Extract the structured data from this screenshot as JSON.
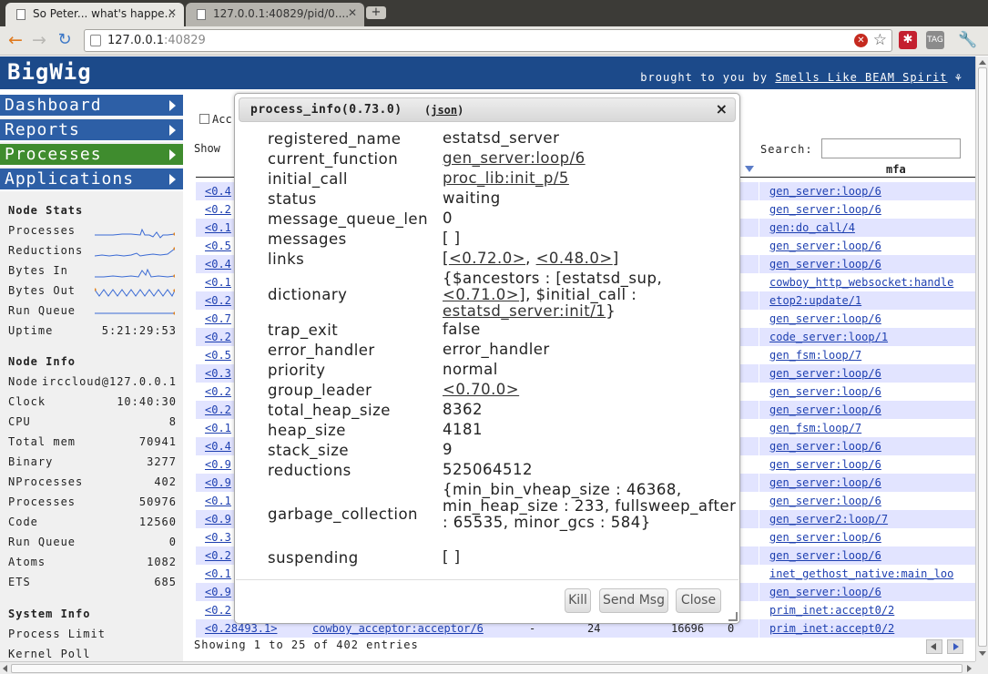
{
  "browser": {
    "tabs": [
      {
        "title": "So Peter... what's happe..."
      },
      {
        "title": "127.0.0.1:40829/pid/0...."
      }
    ],
    "url_host": "127.0.0.1",
    "url_port": ":40829"
  },
  "header": {
    "brand": "BigWig",
    "credit_prefix": "brought to you by",
    "credit_link": "Smells Like BEAM Spirit",
    "credit_icon": "⚘"
  },
  "sidebar": {
    "nav": [
      {
        "label": "Dashboard"
      },
      {
        "label": "Reports"
      },
      {
        "label": "Processes"
      },
      {
        "label": "Applications"
      }
    ],
    "node_stats": {
      "title": "Node Stats",
      "rows": [
        {
          "label": "Processes"
        },
        {
          "label": "Reductions"
        },
        {
          "label": "Bytes In"
        },
        {
          "label": "Bytes Out"
        },
        {
          "label": "Run Queue"
        },
        {
          "label": "Uptime",
          "value": "5:21:29:53"
        }
      ]
    },
    "node_info": {
      "title": "Node Info",
      "rows": [
        {
          "label": "Node",
          "value": "irccloud@127.0.0.1"
        },
        {
          "label": "Clock",
          "value": "10:40:30"
        },
        {
          "label": "CPU",
          "value": "8"
        },
        {
          "label": "Total mem",
          "value": "70941"
        },
        {
          "label": "Binary",
          "value": "3277"
        },
        {
          "label": "NProcesses",
          "value": "402"
        },
        {
          "label": "Processes",
          "value": "50976"
        },
        {
          "label": "Code",
          "value": "12560"
        },
        {
          "label": "Run Queue",
          "value": "0"
        },
        {
          "label": "Atoms",
          "value": "1082"
        },
        {
          "label": "ETS",
          "value": "685"
        }
      ]
    },
    "system_info": {
      "title": "System Info",
      "rows": [
        {
          "label": "Process Limit"
        },
        {
          "label": "Kernel Poll"
        }
      ]
    }
  },
  "main": {
    "accumulate_label": "Acc",
    "show_label": "Show",
    "search_label": "Search:",
    "mfa_header": "mfa",
    "rows": [
      {
        "pid": "<0.4",
        "mfa": "gen_server:loop/6"
      },
      {
        "pid": "<0.2",
        "mfa": "gen_server:loop/6"
      },
      {
        "pid": "<0.1",
        "mfa": "gen:do_call/4"
      },
      {
        "pid": "<0.5",
        "mfa": "gen_server:loop/6"
      },
      {
        "pid": "<0.4",
        "mfa": "gen_server:loop/6"
      },
      {
        "pid": "<0.1",
        "mfa": "cowboy_http_websocket:handle"
      },
      {
        "pid": "<0.2",
        "mfa": "etop2:update/1"
      },
      {
        "pid": "<0.7",
        "mfa": "gen_server:loop/6"
      },
      {
        "pid": "<0.2",
        "mfa": "code_server:loop/1"
      },
      {
        "pid": "<0.5",
        "mfa": "gen_fsm:loop/7"
      },
      {
        "pid": "<0.3",
        "mfa": "gen_server:loop/6"
      },
      {
        "pid": "<0.2",
        "mfa": "gen_server:loop/6"
      },
      {
        "pid": "<0.2",
        "mfa": "gen_server:loop/6"
      },
      {
        "pid": "<0.1",
        "mfa": "gen_fsm:loop/7"
      },
      {
        "pid": "<0.4",
        "mfa": "gen_server:loop/6"
      },
      {
        "pid": "<0.9",
        "mfa": "gen_server:loop/6"
      },
      {
        "pid": "<0.9",
        "mfa": "gen_server:loop/6"
      },
      {
        "pid": "<0.1",
        "mfa": "gen_server:loop/6"
      },
      {
        "pid": "<0.9",
        "mfa": "gen_server2:loop/7"
      },
      {
        "pid": "<0.3",
        "mfa": "gen_server:loop/6"
      },
      {
        "pid": "<0.2",
        "mfa": "gen_server:loop/6"
      },
      {
        "pid": "<0.1",
        "mfa": "inet_gethost_native:main_loo"
      },
      {
        "pid": "<0.9",
        "mfa": "gen_server:loop/6"
      },
      {
        "pid": "<0.2",
        "mfa": "prim_inet:accept0/2"
      }
    ],
    "last_row": {
      "pid": "<0.28493.1>",
      "current_function": "cowboy_acceptor:acceptor/6",
      "c3": "-",
      "c4": "24",
      "c5": "16696",
      "c6": "0",
      "mfa": "prim_inet:accept0/2"
    },
    "showing_text": "Showing 1 to 25 of 402 entries"
  },
  "dialog": {
    "title": "process_info(0.73.0)",
    "json_link": "(json)",
    "close_glyph": "×",
    "fields": {
      "registered_name": {
        "key": "registered_name",
        "value": "estatsd_server"
      },
      "current_function": {
        "key": "current_function",
        "value": "gen_server:loop/6"
      },
      "initial_call": {
        "key": "initial_call",
        "value": "proc_lib:init_p/5"
      },
      "status": {
        "key": "status",
        "value": "waiting"
      },
      "message_queue_len": {
        "key": "message_queue_len",
        "value": "0"
      },
      "messages": {
        "key": "messages",
        "value": "[ ]"
      },
      "links": {
        "key": "links",
        "open": "[",
        "link1": "<0.72.0>",
        "comma": ", ",
        "link2": "<0.48.0>",
        "close": "]"
      },
      "dictionary": {
        "key": "dictionary",
        "part1": "{$ancestors : [estatsd_sup,",
        "link1": "<0.71.0>",
        "part2": "], $initial_call :",
        "link2": "estatsd_server:init/1",
        "part3": "}"
      },
      "trap_exit": {
        "key": "trap_exit",
        "value": "false"
      },
      "error_handler": {
        "key": "error_handler",
        "value": "error_handler"
      },
      "priority": {
        "key": "priority",
        "value": "normal"
      },
      "group_leader": {
        "key": "group_leader",
        "value": "<0.70.0>"
      },
      "total_heap_size": {
        "key": "total_heap_size",
        "value": "8362"
      },
      "heap_size": {
        "key": "heap_size",
        "value": "4181"
      },
      "stack_size": {
        "key": "stack_size",
        "value": "9"
      },
      "reductions": {
        "key": "reductions",
        "value": "525064512"
      },
      "garbage_collection": {
        "key": "garbage_collection",
        "value": "{min_bin_vheap_size : 46368, min_heap_size : 233, fullsweep_after : 65535, minor_gcs : 584}"
      },
      "suspending": {
        "key": "suspending",
        "value": "[ ]"
      }
    },
    "buttons": {
      "kill": "Kill",
      "send_msg": "Send Msg",
      "close": "Close"
    }
  },
  "colors": {
    "header_blue": "#1c4a8a",
    "nav_blue": "#2d5fa6",
    "nav_active_green": "#3f8c2e",
    "link_blue": "#1d3fb0",
    "row_stripe": "#e2e4ff"
  },
  "icons": {
    "back": "back-arrow-icon",
    "forward": "forward-arrow-icon",
    "reload": "reload-icon",
    "star": "bookmark-star-icon",
    "wrench": "wrench-menu-icon"
  }
}
